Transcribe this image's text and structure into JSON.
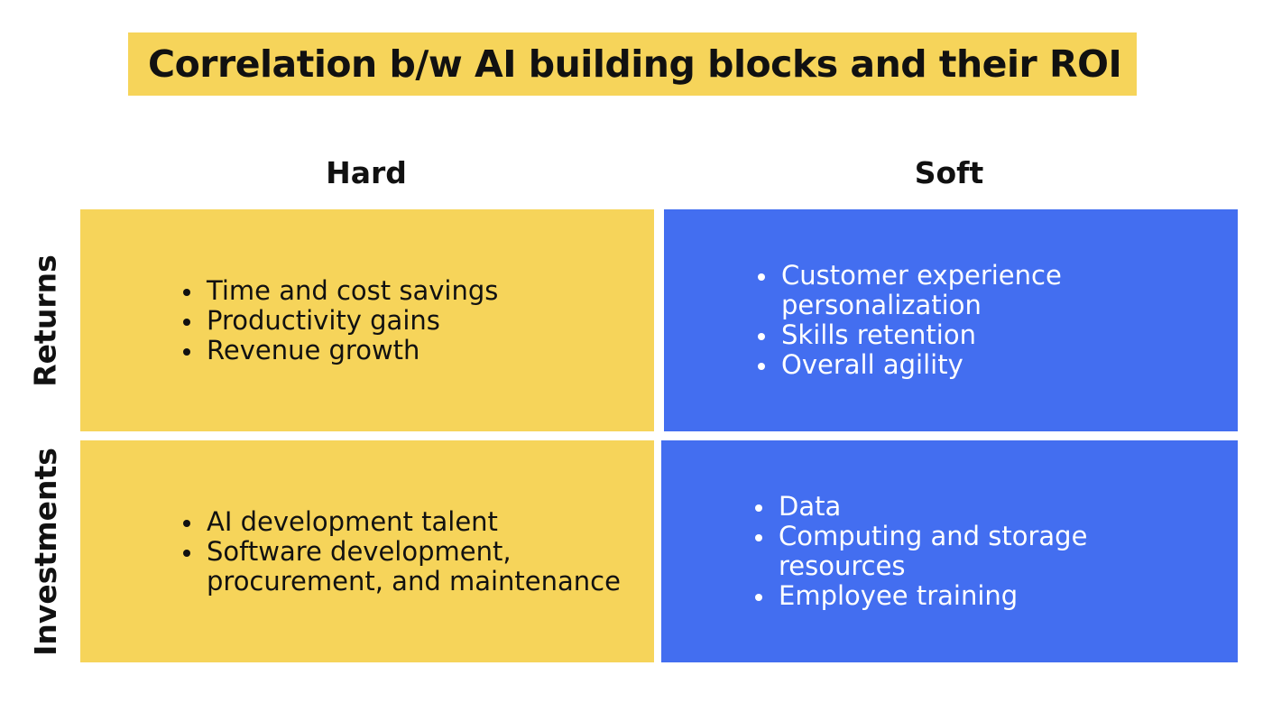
{
  "title": "Correlation b/w AI building blocks and their ROI",
  "columns": {
    "hard": "Hard",
    "soft": "Soft"
  },
  "rows": {
    "returns": "Returns",
    "investments": "Investments"
  },
  "cells": {
    "returns_hard": {
      "items": [
        "Time and cost savings",
        "Productivity gains",
        "Revenue growth"
      ]
    },
    "returns_soft": {
      "items": [
        "Customer experience personalization",
        "Skills retention",
        "Overall agility"
      ]
    },
    "investments_hard": {
      "items": [
        "AI development talent",
        "Software development, procurement, and maintenance"
      ]
    },
    "investments_soft": {
      "items": [
        "Data",
        "Computing and storage resources",
        "Employee training"
      ]
    }
  },
  "colors": {
    "yellow": "#f6d45a",
    "blue": "#436ef0",
    "text_dark": "#111111",
    "text_light": "#ffffff"
  }
}
